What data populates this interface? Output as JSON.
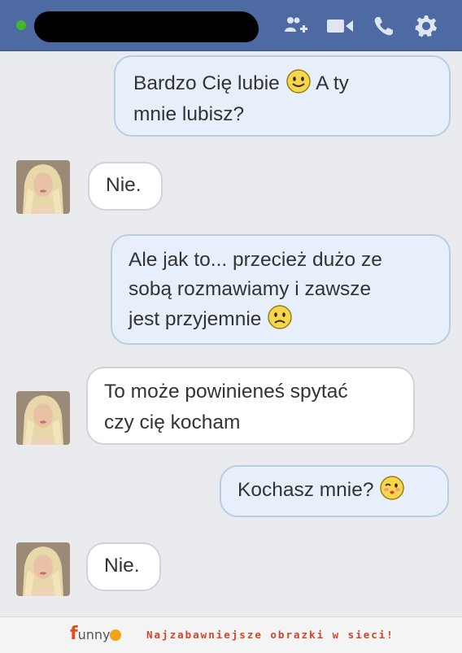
{
  "header": {
    "contact_name_redacted": true,
    "status": "online",
    "icons": [
      "add-people-icon",
      "video-call-icon",
      "phone-icon",
      "gear-icon"
    ]
  },
  "messages": [
    {
      "from": "me",
      "parts": [
        "Bardzo Cię lubie",
        " A ty",
        "mnie lubisz?"
      ],
      "emoji": "smile"
    },
    {
      "from": "them",
      "text": "Nie."
    },
    {
      "from": "me",
      "lines": [
        "Ale jak to... przecież dużo ze",
        "sobą rozmawiamy i zawsze",
        "jest przyjemnie"
      ],
      "emoji": "sad"
    },
    {
      "from": "them",
      "lines": [
        "To może powinieneś spytać",
        "czy cię kocham"
      ]
    },
    {
      "from": "me",
      "text": "Kochasz mnie?",
      "emoji": "kiss"
    },
    {
      "from": "them",
      "text": "Nie."
    }
  ],
  "footer": {
    "logo": "funny",
    "tagline": "Najzabawniejsze obrazki w sieci!"
  },
  "colors": {
    "header": "#4d6aa3",
    "my_bubble": "#e7f0fa",
    "their_bubble": "#ffffff",
    "tagline": "#d1432a"
  }
}
